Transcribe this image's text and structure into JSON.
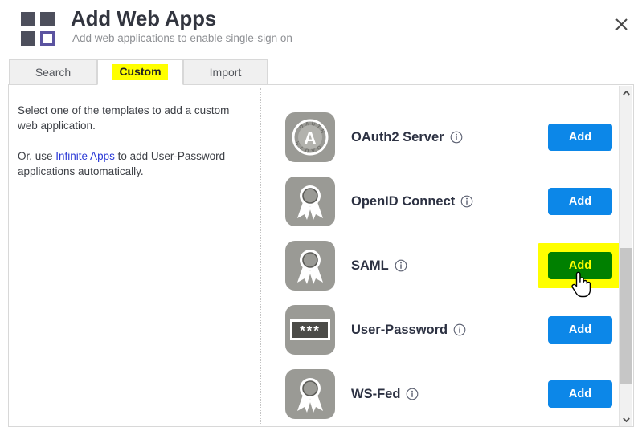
{
  "header": {
    "title": "Add Web Apps",
    "subtitle": "Add web applications to enable single-sign on",
    "logo_icon": "four-squares-logo-icon",
    "close_icon": "close-icon"
  },
  "tabs": [
    {
      "id": "search",
      "label": "Search",
      "active": false,
      "highlighted": false
    },
    {
      "id": "custom",
      "label": "Custom",
      "active": true,
      "highlighted": true
    },
    {
      "id": "import",
      "label": "Import",
      "active": false,
      "highlighted": false
    }
  ],
  "left_panel": {
    "paragraph1": "Select one of the templates to add a custom web application.",
    "paragraph2_prefix": "Or, use ",
    "link_text": "Infinite Apps",
    "paragraph2_suffix": " to add User-Password applications automatically."
  },
  "templates": [
    {
      "name": "OAuth2 Server",
      "icon": "oauth-badge-icon",
      "info_icon": "info-icon",
      "button_label": "Add",
      "button_state": "default",
      "highlighted": false
    },
    {
      "name": "OpenID Connect",
      "icon": "award-ribbon-icon",
      "info_icon": "info-icon",
      "button_label": "Add",
      "button_state": "default",
      "highlighted": false
    },
    {
      "name": "SAML",
      "icon": "award-ribbon-icon",
      "info_icon": "info-icon",
      "button_label": "Add",
      "button_state": "hovered",
      "highlighted": true
    },
    {
      "name": "User-Password",
      "icon": "password-asterisks-icon",
      "info_icon": "info-icon",
      "button_label": "Add",
      "button_state": "default",
      "highlighted": false
    },
    {
      "name": "WS-Fed",
      "icon": "award-ribbon-icon",
      "info_icon": "info-icon",
      "button_label": "Add",
      "button_state": "default",
      "highlighted": false
    }
  ],
  "scrollbar": {
    "up_icon": "chevron-up-icon",
    "down_icon": "chevron-down-icon",
    "thumb": "scrollbar-thumb"
  },
  "cursor": {
    "icon": "hand-pointer-cursor"
  },
  "colors": {
    "accent_blue": "#0c87e8",
    "highlight_yellow": "#ffff00",
    "hover_green": "#008000",
    "link_blue": "#2b3ad6",
    "icon_tile_gray": "#9a9a95",
    "logo_purple": "#5b53a0"
  }
}
